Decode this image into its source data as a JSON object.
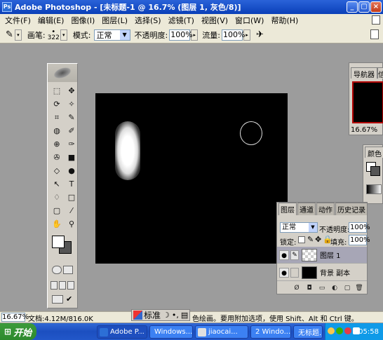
{
  "window": {
    "title": "Adobe Photoshop - [未标题-1 @ 16.7% (图层 1, 灰色/8)]",
    "app_icon": "Ps"
  },
  "menu": [
    "文件(F)",
    "编辑(E)",
    "图像(I)",
    "图层(L)",
    "选择(S)",
    "滤镜(T)",
    "视图(V)",
    "窗口(W)",
    "帮助(H)"
  ],
  "options": {
    "brush_label": "画笔:",
    "brush_size": "322",
    "mode_label": "模式:",
    "mode_value": "正常",
    "opacity_label": "不透明度:",
    "opacity_value": "100%",
    "flow_label": "流量:",
    "flow_value": "100%"
  },
  "toolbox": {
    "tools": [
      "⬚",
      "✥",
      "⟳",
      "✧",
      "⌗",
      "✎",
      "◍",
      "✐",
      "⊕",
      "✑",
      "✇",
      "■",
      "◇",
      "●",
      "↖",
      "T",
      "♢",
      "□",
      "▢",
      "⁄",
      "✋",
      "⚲"
    ]
  },
  "navigator": {
    "tab_label": "导航器",
    "tab2_label": "信",
    "zoom": "16.67%"
  },
  "color_panel": {
    "tab_label": "颜色"
  },
  "layers": {
    "tabs": [
      "图层",
      "通道",
      "动作",
      "历史记录"
    ],
    "mode_value": "正常",
    "opacity_label": "不透明度:",
    "opacity_value": "100%",
    "lock_label": "锁定:",
    "fill_label": "填充:",
    "fill_value": "100%",
    "items": [
      {
        "name": "图层 1",
        "selected": true
      },
      {
        "name": "背景 副本",
        "selected": false
      }
    ]
  },
  "status": {
    "zoom": "16.67%",
    "doc": "文档:4.12M/816.0K",
    "hint": "色绘画。要用附加选项，使用 Shift、Alt 和 Ctrl 键。",
    "ime_label": "标准"
  },
  "taskbar": {
    "start_label": "开始",
    "tasks": [
      "Adobe P...",
      "Windows...",
      "jiaocai...",
      "2 Windo...",
      "无标题..."
    ],
    "clock": "05:58"
  },
  "colors": {
    "accent": "#0a3fb8",
    "canvas": "#000000",
    "workspace": "#9c9c9c"
  }
}
